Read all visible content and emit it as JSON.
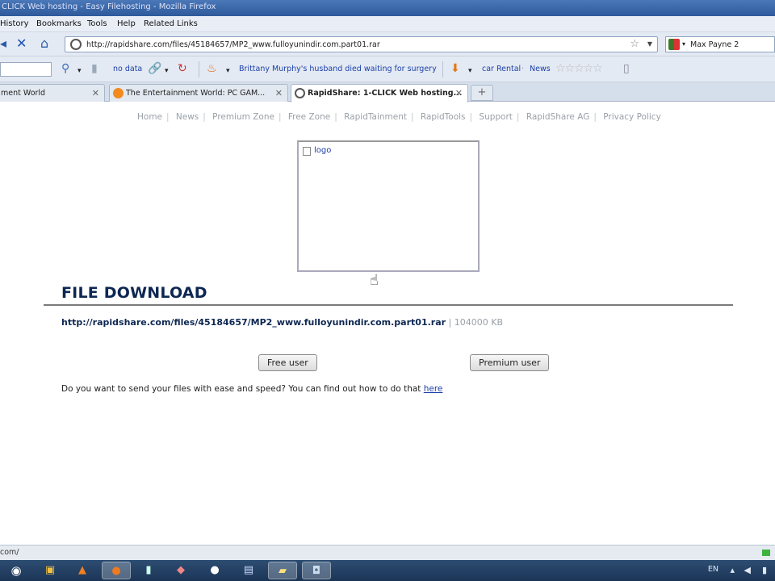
{
  "window": {
    "title": "CLICK Web hosting - Easy Filehosting - Mozilla Firefox"
  },
  "menu": [
    "History",
    "Bookmarks",
    "Tools",
    "Help",
    "Related Links"
  ],
  "nav": {
    "url": "http://rapidshare.com/files/45184657/MP2_www.fulloyunindir.com.part01.rar",
    "search_value": "Max Payne 2"
  },
  "toolbar": {
    "no_data": "no data",
    "headline": "Brittany Murphy's husband died waiting for surgery",
    "car_rental": "car Rental",
    "news": "News"
  },
  "tabs": [
    {
      "label": "ment World",
      "active": false
    },
    {
      "label": "The Entertainment World: PC GAM...",
      "active": false
    },
    {
      "label": "RapidShare: 1-CLICK Web hosting...",
      "active": true
    }
  ],
  "page": {
    "topnav": [
      "Home",
      "News",
      "Premium Zone",
      "Free Zone",
      "RapidTainment",
      "RapidTools",
      "Support",
      "RapidShare AG",
      "Privacy Policy"
    ],
    "logo_alt": "logo",
    "heading": "FILE DOWNLOAD",
    "file_link": "http://rapidshare.com/files/45184657/MP2_www.fulloyunindir.com.part01.rar",
    "file_size_sep": " | ",
    "file_size": "104000 KB",
    "free_button": "Free user",
    "premium_button": "Premium user",
    "send_text": "Do you want to send your files with ease and speed? You can find out how to do that ",
    "send_link": "here"
  },
  "status": {
    "text": "com/"
  },
  "tray": {
    "lang": "EN"
  },
  "colors": {
    "heading": "#0d2752",
    "link": "#1a3fa8",
    "muted": "#9aa0a8"
  }
}
